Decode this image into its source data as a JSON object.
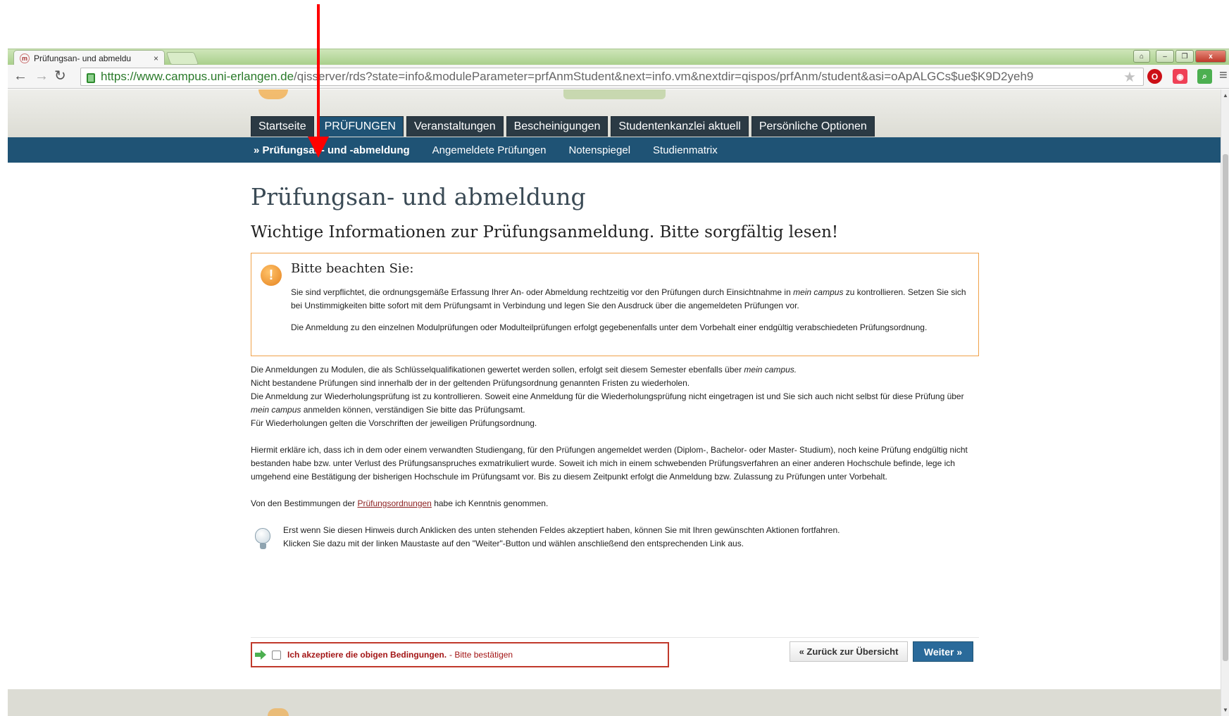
{
  "browser": {
    "tab_title": "Prüfungsan- und abmeldu",
    "tab_close": "×",
    "url_scheme_host": "https://www.campus.uni-erlangen.de",
    "url_path": "/qisserver/rds?state=info&moduleParameter=prfAnmStudent&next=info.vm&nextdir=qispos/prfAnm/student&asi=oApALGCs$ue$K9D2yeh9",
    "window_controls": [
      "–",
      "❐",
      "x"
    ],
    "icons": [
      "back-icon",
      "forward-icon",
      "reload-icon",
      "lock-icon",
      "star-icon",
      "opera-icon",
      "pocket-icon",
      "menu-icon"
    ]
  },
  "main_nav": {
    "tabs": [
      {
        "label": "Startseite",
        "active": false
      },
      {
        "label": "PRÜFUNGEN",
        "active": true
      },
      {
        "label": "Veranstaltungen",
        "active": false
      },
      {
        "label": "Bescheinigungen",
        "active": false
      },
      {
        "label": "Studentenkanzlei aktuell",
        "active": false
      },
      {
        "label": "Persönliche Optionen",
        "active": false
      }
    ]
  },
  "sub_nav": {
    "items": [
      {
        "label": "» Prüfungsan- und -abmeldung",
        "active": true
      },
      {
        "label": "Angemeldete Prüfungen",
        "active": false
      },
      {
        "label": "Notenspiegel",
        "active": false
      },
      {
        "label": "Studienmatrix",
        "active": false
      }
    ]
  },
  "page": {
    "title": "Prüfungsan- und abmeldung",
    "subtitle": "Wichtige Informationen zur Prüfungsanmeldung. Bitte sorgfältig lesen!"
  },
  "notice": {
    "heading": "Bitte beachten Sie:",
    "p1_before": "Sie sind verpflichtet, die ordnungsgemäße Erfassung Ihrer An- oder Abmeldung rechtzeitig vor den Prüfungen durch Einsichtnahme in ",
    "p1_em": "mein campus",
    "p1_after": " zu kontrollieren. Setzen Sie sich bei Unstimmigkeiten bitte sofort mit dem Prüfungsamt in Verbindung und legen Sie den Ausdruck über die angemeldeten Prüfungen vor.",
    "p2": "Die Anmeldung zu den einzelnen Modulprüfungen oder Modulteilprüfungen erfolgt gegebenenfalls unter dem Vorbehalt einer endgültig verabschiedeten Prüfungsordnung."
  },
  "info": {
    "line1_before": "Die Anmeldungen zu Modulen, die als Schlüsselqualifikationen gewertet werden sollen, erfolgt seit diesem Semester ebenfalls über ",
    "line1_em": "mein campus.",
    "line2": "Nicht bestandene Prüfungen sind innerhalb der in der geltenden Prüfungsordnung genannten Fristen zu wiederholen.",
    "line3_before": "Die Anmeldung zur Wiederholungsprüfung ist zu kontrollieren. Soweit eine Anmeldung für die Wiederholungsprüfung nicht eingetragen ist und Sie sich auch nicht selbst für diese Prüfung über ",
    "line3_em": "mein campus",
    "line3_after": " anmelden können, verständigen Sie bitte das Prüfungsamt.",
    "line4": "Für Wiederholungen gelten die Vorschriften der jeweiligen Prüfungsordnung.",
    "declaration": "Hiermit erkläre ich, dass ich in dem oder einem verwandten Studiengang, für den Prüfungen angemeldet werden (Diplom-, Bachelor- oder Master- Studium), noch keine Prüfung endgültig nicht bestanden habe bzw. unter Verlust des Prüfungsanspruches exmatrikuliert wurde. Soweit ich mich in einem schwebenden Prüfungsverfahren an einer anderen Hochschule befinde, lege ich umgehend eine Bestätigung der bisherigen Hochschule im Prüfungsamt vor. Bis zu diesem Zeitpunkt erfolgt die Anmeldung bzw. Zulassung zu Prüfungen unter Vorbehalt.",
    "regulations_before": "Von den Bestimmungen der ",
    "regulations_link": "Prüfungsordnungen",
    "regulations_after": " habe ich Kenntnis genommen."
  },
  "hint": {
    "line1": "Erst wenn Sie diesen Hinweis durch Anklicken des unten stehenden Feldes akzeptiert haben, können Sie mit Ihren gewünschten Aktionen fortfahren.",
    "line2": "Klicken Sie dazu mit der linken Maustaste auf den \"Weiter\"-Button und wählen anschließend den entsprechenden Link aus."
  },
  "form": {
    "accept_label": "Ich akzeptiere die obigen Bedingungen.",
    "accept_hint": "- Bitte bestätigen",
    "accepted": false,
    "back_button": "« Zurück zur Übersicht",
    "next_button": "Weiter »"
  },
  "colors": {
    "nav_dark": "#2b3a44",
    "nav_blue": "#1f5375",
    "notice_border": "#f0a24a",
    "error_red": "#c0392b",
    "annotation_red": "#ff0000"
  }
}
